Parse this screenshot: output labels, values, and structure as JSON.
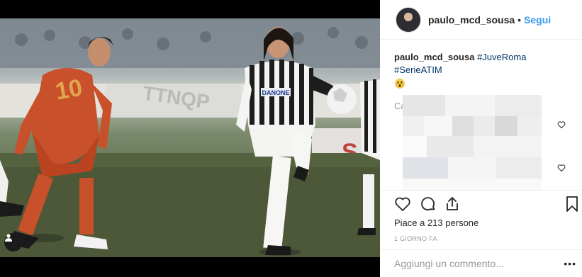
{
  "post": {
    "username": "paulo_mcd_sousa",
    "separator": "•",
    "follow_label": "Segui"
  },
  "caption": {
    "username": "paulo_mcd_sousa",
    "hashtags": [
      "#JuveRoma",
      "#SerieATIM"
    ],
    "emoji_icon": "scream-emoji-icon"
  },
  "load_more_label": "Carica altri commenti",
  "likes_text": "Piace a 213 persone",
  "time_ago": "1 GIORNO FA",
  "comment_input": {
    "placeholder": "Aggiungi un commento..."
  },
  "options_label": "•••",
  "photo": {
    "left_player_number": "10",
    "sponsor_text": "DANONE"
  },
  "colors": {
    "follow_blue": "#3897f0",
    "hashtag_blue": "#003569",
    "text_primary": "#262626",
    "text_secondary": "#999999",
    "roma_shirt": "#c8502a"
  }
}
